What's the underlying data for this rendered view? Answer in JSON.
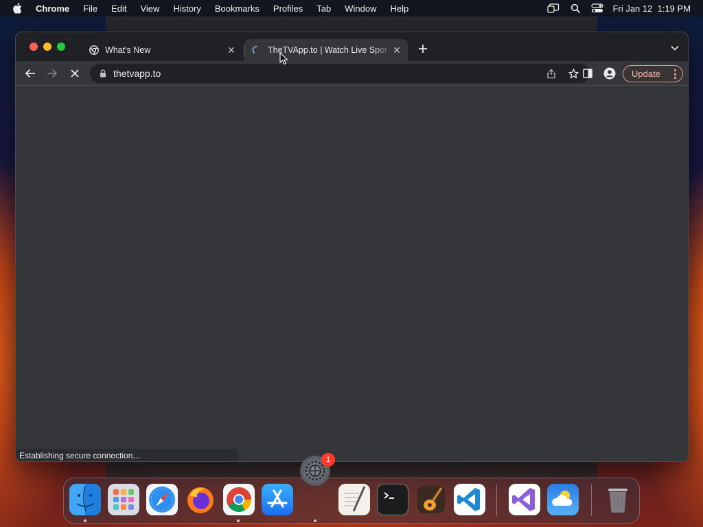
{
  "menubar": {
    "app_name": "Chrome",
    "items": [
      "File",
      "Edit",
      "View",
      "History",
      "Bookmarks",
      "Profiles",
      "Tab",
      "Window",
      "Help"
    ],
    "datetime": "Fri Jan 12  1:19 PM"
  },
  "tabs": [
    {
      "title": "What's New",
      "icon": "chrome-icon",
      "active": false
    },
    {
      "title": "TheTVApp.to | Watch Live Spor",
      "icon": "loading-spinner-icon",
      "active": true
    }
  ],
  "toolbar": {
    "url": "thetvapp.to",
    "update_label": "Update"
  },
  "status": {
    "text": "Establishing secure connection..."
  },
  "dock": {
    "badge_count": "1",
    "apps": [
      "Finder",
      "Launchpad",
      "Safari",
      "Firefox",
      "Chrome",
      "App Store",
      "System Settings",
      "TextEdit",
      "Terminal",
      "GarageBand",
      "VS Code",
      "Visual Studio",
      "Weather",
      "Trash"
    ]
  },
  "colors": {
    "tabstrip": "#202124",
    "toolbar": "#35363a",
    "update_accent": "#e19c8f"
  }
}
